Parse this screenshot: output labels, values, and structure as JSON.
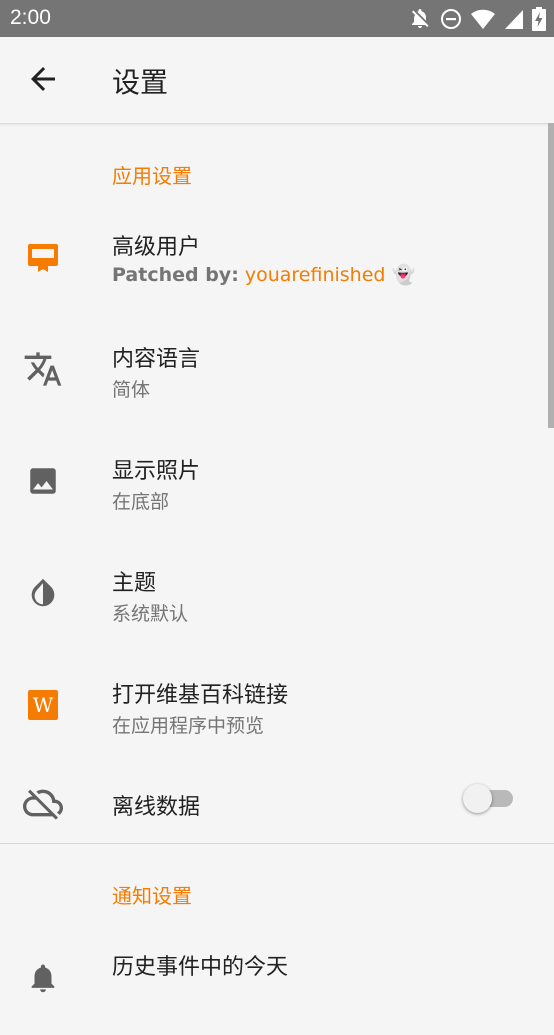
{
  "status_bar": {
    "time": "2:00",
    "icons": [
      "notifications-off-icon",
      "do-not-disturb-icon",
      "wifi-icon",
      "cellular-signal-icon",
      "battery-charging-icon"
    ]
  },
  "app_bar": {
    "back_icon": "arrow-back-icon",
    "title": "设置"
  },
  "sections": {
    "app_settings": {
      "header": "应用设置",
      "items": [
        {
          "title": "高级用户",
          "subtitle_label": "Patched by:",
          "subtitle_name": "youarefinished",
          "subtitle_emoji": "👻",
          "icon": "premium-card-icon",
          "icon_color": "#f57c00"
        },
        {
          "title": "内容语言",
          "subtitle": "简体",
          "icon": "translate-icon"
        },
        {
          "title": "显示照片",
          "subtitle": "在底部",
          "icon": "image-icon"
        },
        {
          "title": "主题",
          "subtitle": "系统默认",
          "icon": "theme-drop-icon"
        },
        {
          "title": "打开维基百科链接",
          "subtitle": "在应用程序中预览",
          "icon": "wikipedia-icon",
          "icon_text": "W",
          "icon_color": "#f57c00"
        },
        {
          "title": "离线数据",
          "icon": "cloud-off-icon",
          "toggle_on": false
        }
      ]
    },
    "notification_settings": {
      "header": "通知设置",
      "items": [
        {
          "title": "历史事件中的今天",
          "icon": "bell-icon"
        }
      ]
    }
  },
  "colors": {
    "accent": "#f57c00",
    "status_bar": "#757575",
    "background": "#f5f5f5",
    "primary_text": "#212121",
    "secondary_text": "#757575",
    "icon": "#616161"
  }
}
